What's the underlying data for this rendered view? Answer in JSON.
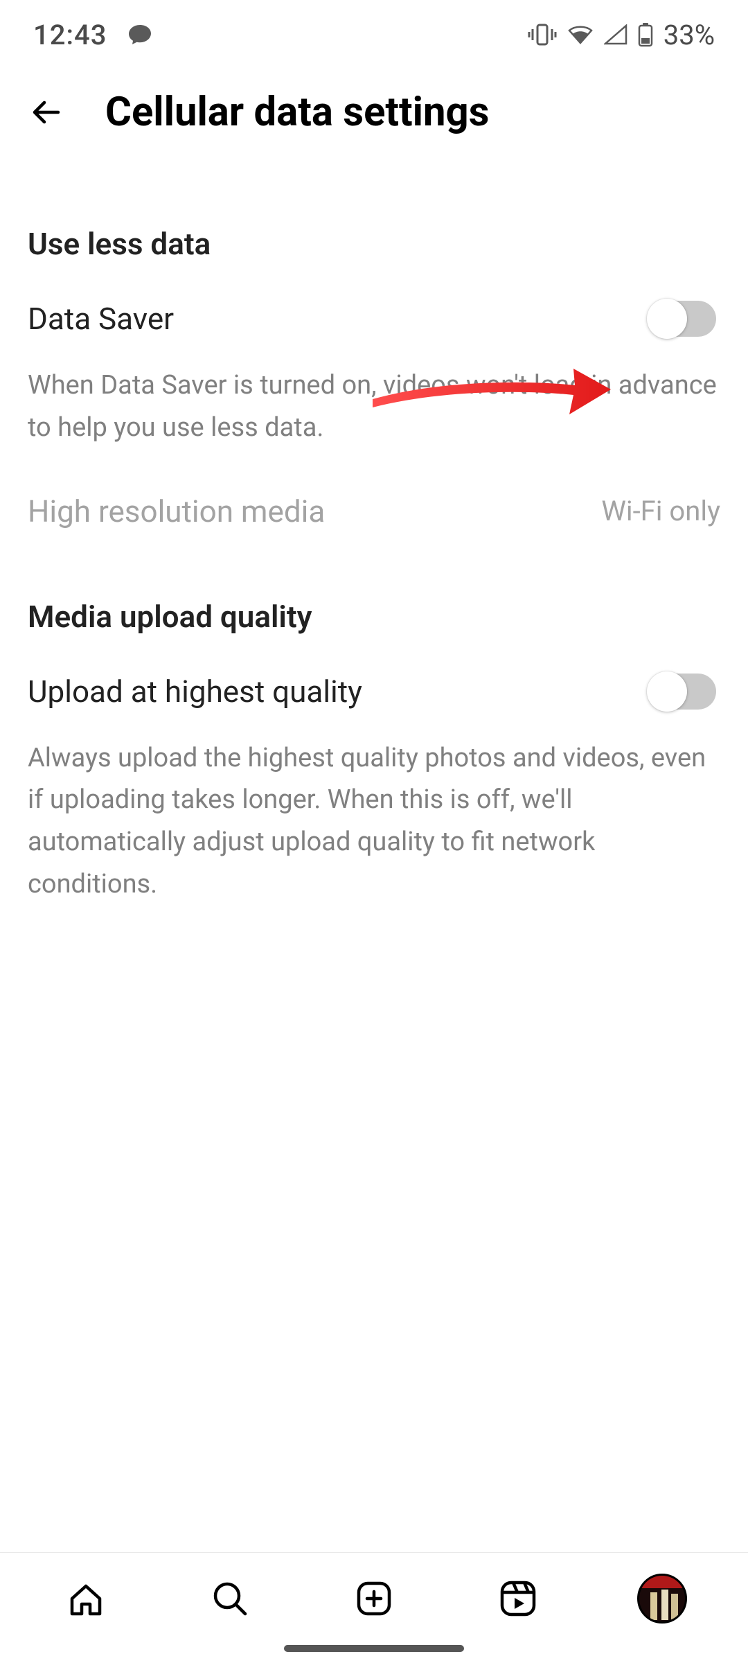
{
  "statusbar": {
    "time": "12:43",
    "battery_pct": "33%"
  },
  "header": {
    "title": "Cellular data settings"
  },
  "sections": {
    "use_less_data": {
      "heading": "Use less data",
      "data_saver": {
        "label": "Data Saver",
        "description": "When Data Saver is turned on, videos won't load in advance to help you use less data.",
        "enabled": false
      },
      "high_res": {
        "label": "High resolution media",
        "value": "Wi-Fi only"
      }
    },
    "media_upload": {
      "heading": "Media upload quality",
      "upload_highest": {
        "label": "Upload at highest quality",
        "description": "Always upload the highest quality photos and videos, even if uploading takes longer. When this is off, we'll automatically adjust upload quality to fit network conditions.",
        "enabled": false
      }
    }
  }
}
